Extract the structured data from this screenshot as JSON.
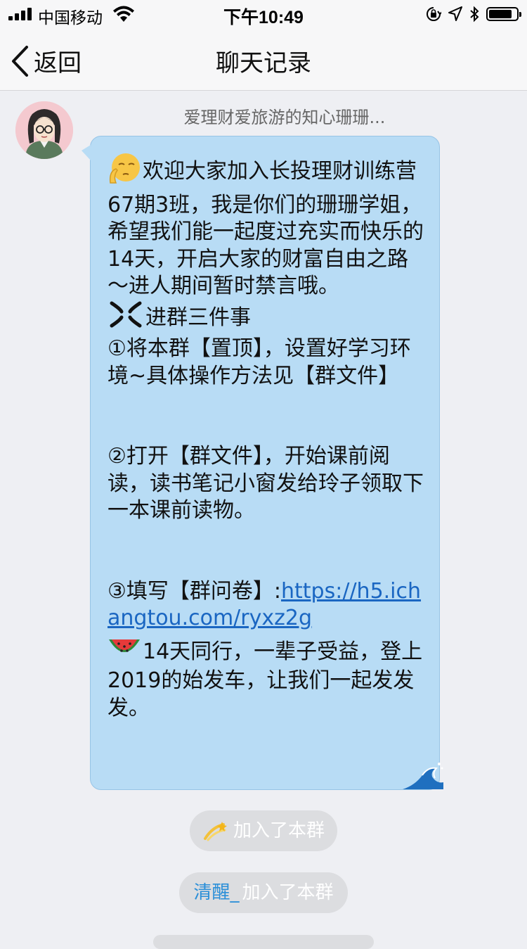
{
  "status_bar": {
    "carrier": "中国移动",
    "time": "下午10:49",
    "battery_level": 0.85
  },
  "nav": {
    "back_label": "返回",
    "title": "聊天记录"
  },
  "message": {
    "sender": "爱理财爱旅游的知心珊珊...",
    "paragraph1": "欢迎大家加入长投理财训练营67期3班，我是你们的珊珊学姐，希望我们能一起度过充实而快乐的14天，开启大家的财富自由之路～进人期间暂时禁言哦。",
    "heading": "进群三件事",
    "item1": "①将本群【置顶】，设置好学习环境~具体操作方法见【群文件】",
    "item2": "②打开【群文件】，开始课前阅读，读书笔记小窗发给玲子领取下一本课前读物。",
    "item3_prefix": "③填写【群问卷】:",
    "item3_link": "https://h5.ichangtou.com/ryxz2g",
    "closing": "14天同行，一辈子受益，登上2019的始发车，让我们一起发发发。"
  },
  "system_messages": [
    {
      "name": "",
      "text": "加入了本群"
    },
    {
      "name": "清醒_",
      "text": "加入了本群"
    }
  ],
  "colors": {
    "bubble": "#b8dcf5",
    "link": "#1a66c2",
    "system_name": "#2b8fd8"
  }
}
